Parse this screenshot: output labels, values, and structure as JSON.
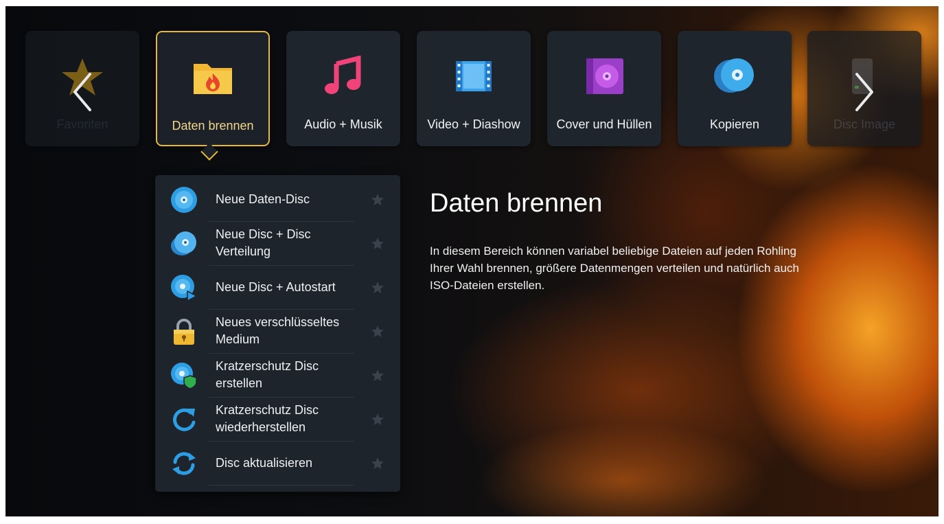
{
  "categories": [
    {
      "label": "Favoriten",
      "icon": "star-icon",
      "state": "faded"
    },
    {
      "label": "Daten brennen",
      "icon": "folder-fire-icon",
      "state": "selected"
    },
    {
      "label": "Audio + Musik",
      "icon": "music-note-icon",
      "state": "normal"
    },
    {
      "label": "Video + Diashow",
      "icon": "film-strip-icon",
      "state": "normal"
    },
    {
      "label": "Cover und Hüllen",
      "icon": "disc-cover-icon",
      "state": "normal"
    },
    {
      "label": "Kopieren",
      "icon": "disc-copy-icon",
      "state": "normal"
    },
    {
      "label": "Disc Image",
      "icon": "disc-image-icon",
      "state": "faded"
    }
  ],
  "submenu": {
    "items": [
      {
        "label": "Neue Daten-Disc",
        "icon": "disc-icon"
      },
      {
        "label": "Neue Disc + Disc Verteilung",
        "icon": "disc-stack-icon"
      },
      {
        "label": "Neue Disc + Autostart",
        "icon": "disc-play-icon"
      },
      {
        "label": "Neues verschlüsseltes Medium",
        "icon": "padlock-icon"
      },
      {
        "label": "Kratzerschutz Disc erstellen",
        "icon": "disc-shield-icon"
      },
      {
        "label": "Kratzerschutz Disc wiederherstellen",
        "icon": "restore-arrow-icon"
      },
      {
        "label": "Disc aktualisieren",
        "icon": "refresh-icon"
      }
    ]
  },
  "description": {
    "title": "Daten brennen",
    "text": "In diesem Bereich können variabel beliebige Dateien auf jeden Rohling Ihrer Wahl brennen, größere Datenmengen verteilen und natürlich auch ISO-Dateien erstellen."
  },
  "colors": {
    "selection_border": "#e8b83a",
    "tile_background": "#1f252d",
    "accent_blue": "#2aa3e8",
    "music_pink": "#f0437a"
  }
}
